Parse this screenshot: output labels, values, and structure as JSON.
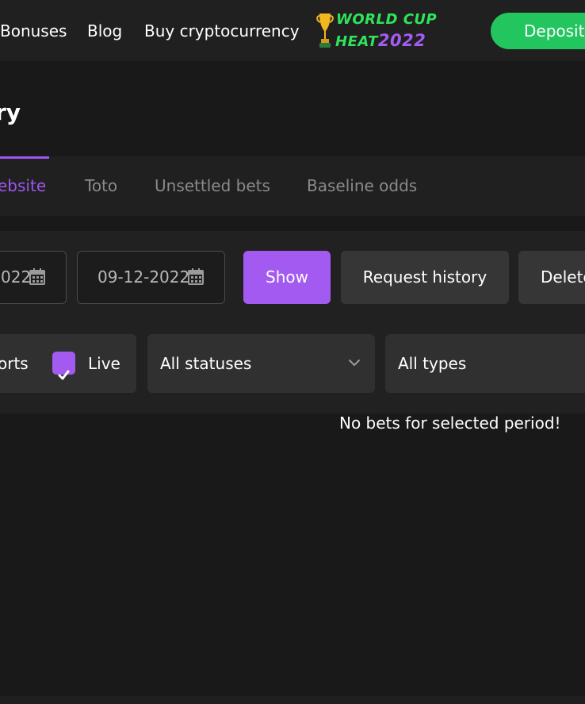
{
  "nav": {
    "bonuses": "Bonuses",
    "blog": "Blog",
    "buy_crypto": "Buy cryptocurrency",
    "promo": {
      "line1": "WORLD CUP",
      "line2_word": "HEAT",
      "line2_year": "2022"
    },
    "deposit": "Deposit"
  },
  "page": {
    "title_partial": "ry"
  },
  "tabs": [
    {
      "label": "ebsite",
      "active": true
    },
    {
      "label": "Toto",
      "active": false
    },
    {
      "label": "Unsettled bets",
      "active": false
    },
    {
      "label": "Baseline odds",
      "active": false
    }
  ],
  "filters": {
    "date_from_partial": "022",
    "date_to": "09-12-2022",
    "show": "Show",
    "request_history": "Request history",
    "delete_partial": "Delete",
    "sports_partial": "orts",
    "live_label": "Live",
    "live_checked": true,
    "status_select": "All statuses",
    "type_select": "All types"
  },
  "empty_message": "No bets for selected period!",
  "colors": {
    "accent": "#a35af0",
    "deposit": "#22c55e",
    "background": "#191919",
    "panel": "#212121"
  }
}
